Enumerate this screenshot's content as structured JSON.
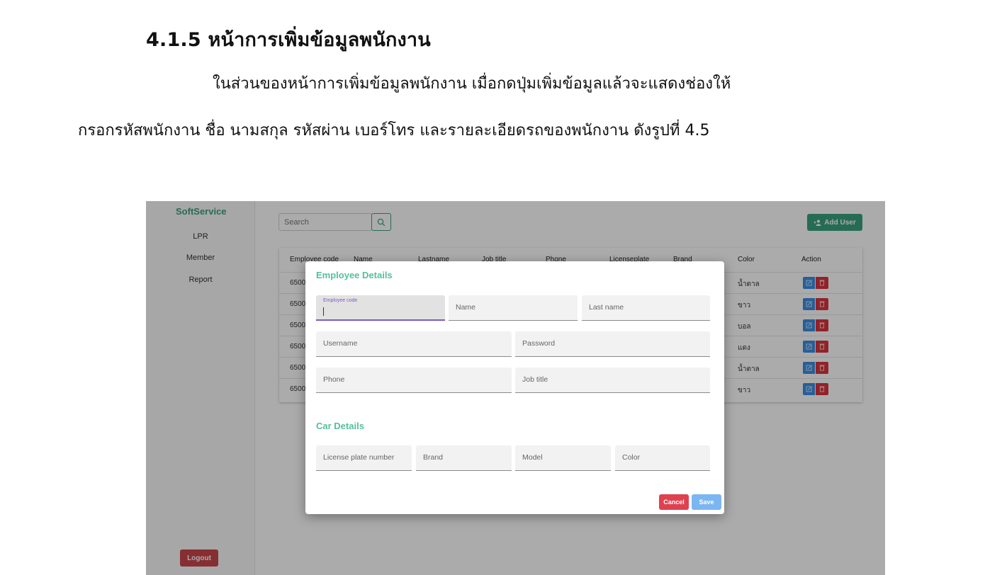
{
  "document": {
    "heading": "4.1.5 หน้าการเพิ่มข้อมูลพนักงาน",
    "paragraph_line_1": "ในส่วนของหน้าการเพิ่มข้อมูลพนักงาน เมื่อกดปุ่มเพิ่มข้อมูลแล้วจะแสดงช่องให้",
    "paragraph_line_2": "กรอกรหัสพนักงาน ชื่อ นามสกุล รหัสผ่าน เบอร์โทร และรายละเอียดรถของพนักงาน ดังรูปที่ 4.5"
  },
  "app": {
    "brand": "SoftService",
    "nav": [
      "LPR",
      "Member",
      "Report"
    ],
    "logout_label": "Logout",
    "search_placeholder": "Search",
    "add_user_label": "Add User",
    "table": {
      "headers": [
        "Employee code",
        "Name",
        "Lastname",
        "Job title",
        "Phone",
        "Licenseplate",
        "Brand",
        "Color",
        "Action"
      ],
      "rows": [
        {
          "code": "6500",
          "color": "น้ำตาล"
        },
        {
          "code": "6500",
          "color": "ขาว"
        },
        {
          "code": "6500",
          "color": "บอล"
        },
        {
          "code": "6500",
          "color": "แดง"
        },
        {
          "code": "6500",
          "color": "น้ำตาล"
        },
        {
          "code": "6500",
          "color": "ขาว"
        }
      ]
    },
    "modal": {
      "employee_section_title": "Employee Details",
      "employee_code_label": "Employee code",
      "name_label": "Name",
      "last_name_label": "Last name",
      "username_label": "Username",
      "password_label": "Password",
      "phone_label": "Phone",
      "job_title_label": "Job title",
      "car_section_title": "Car Details",
      "license_plate_label": "License plate number",
      "brand_label": "Brand",
      "model_label": "Model",
      "color_label": "Color",
      "cancel_label": "Cancel",
      "save_label": "Save"
    }
  },
  "colors": {
    "brand_green": "#3aa17e",
    "section_green": "#55bf9c",
    "danger_red": "#d8353d",
    "edit_blue": "#3b8ee0",
    "save_blue": "#7bb6f2",
    "focus_purple": "#7a5ac8"
  },
  "icons": [
    "search-icon",
    "add-user-icon",
    "edit-icon",
    "delete-icon"
  ]
}
